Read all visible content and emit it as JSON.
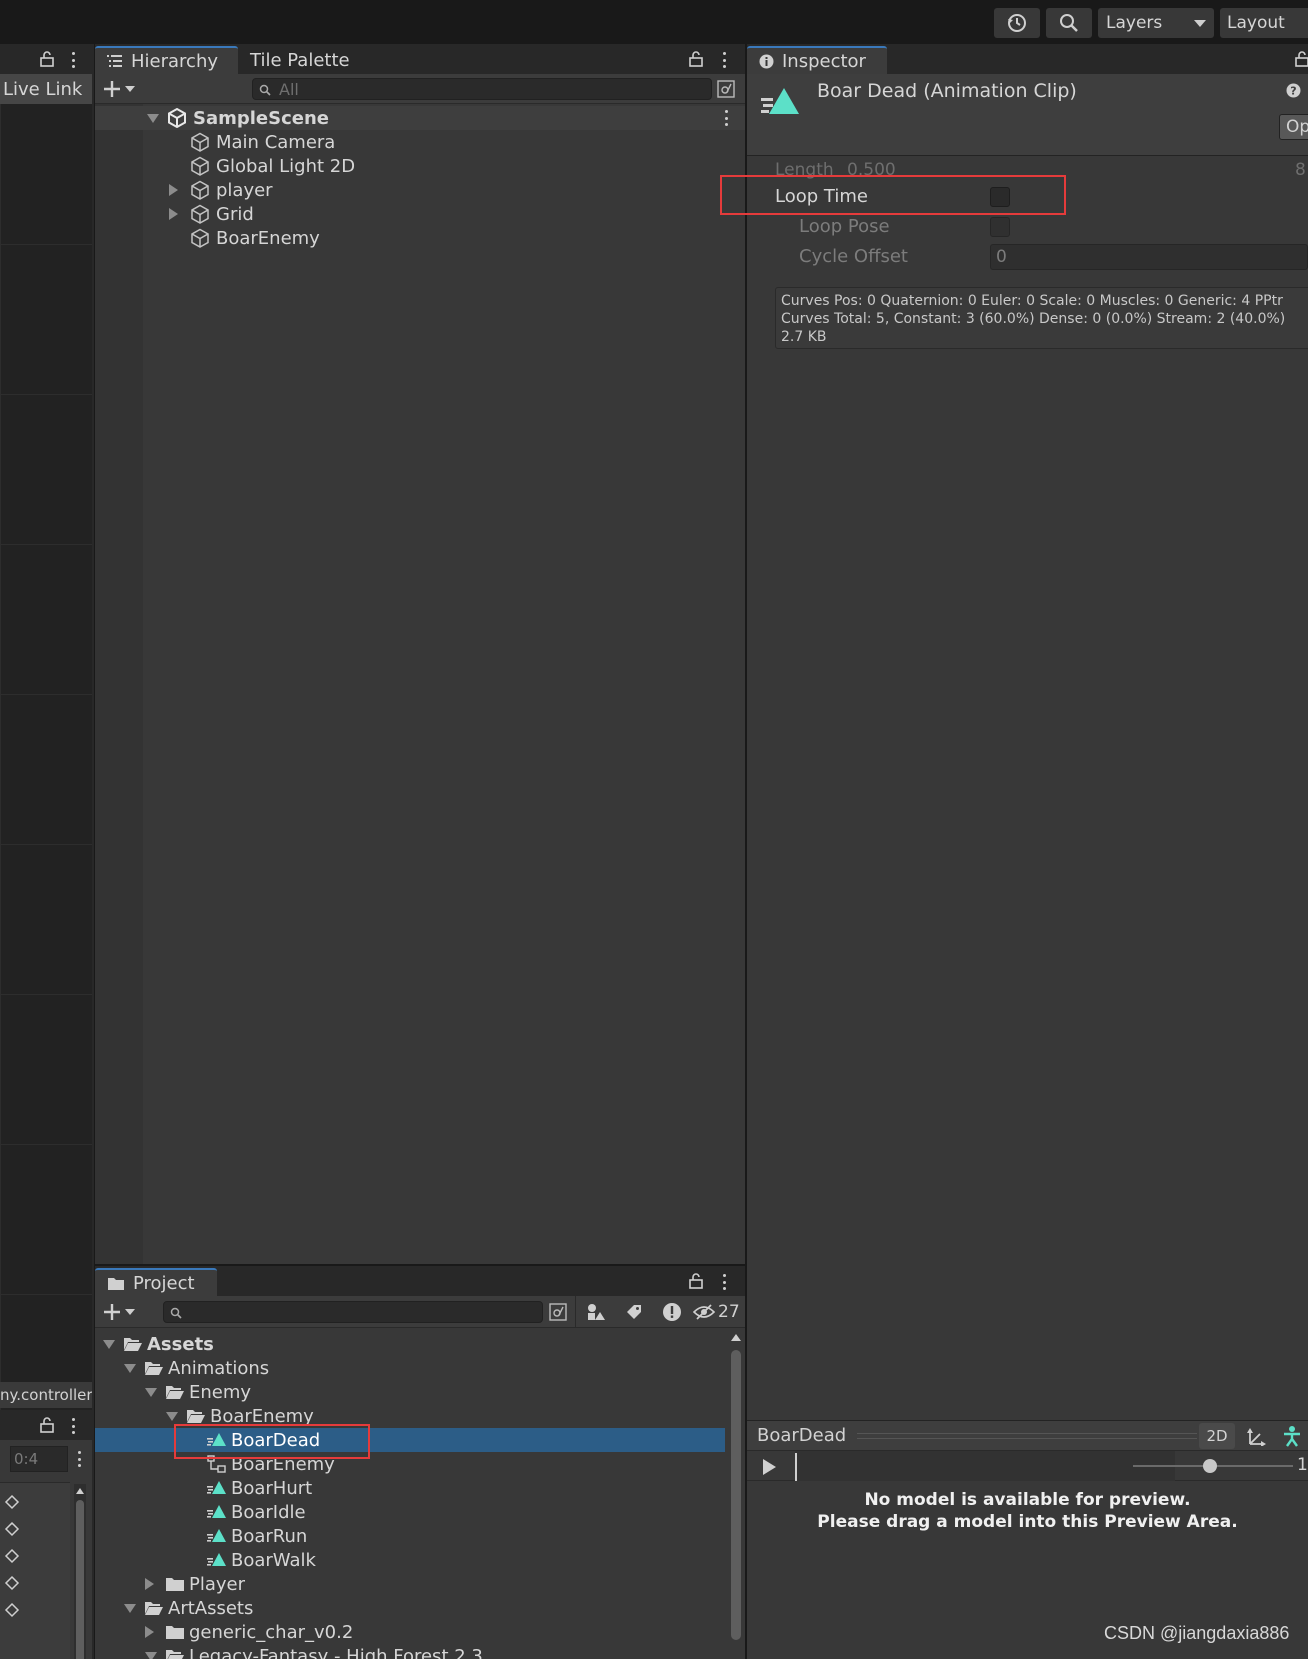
{
  "toolbar": {
    "history_icon": "history-icon",
    "search_icon": "search-icon",
    "layers_label": "Layers",
    "layout_label": "Layout"
  },
  "left_panel": {
    "live_link_label": "Live Link",
    "controller_label": "ny.controller",
    "frame_field": "0:4"
  },
  "hierarchy": {
    "tab_label": "Hierarchy",
    "tab2_label": "Tile Palette",
    "search_placeholder": "All",
    "scene_name": "SampleScene",
    "items": [
      {
        "label": "Main Camera",
        "expandable": false
      },
      {
        "label": "Global Light 2D",
        "expandable": false
      },
      {
        "label": "player",
        "expandable": true
      },
      {
        "label": "Grid",
        "expandable": true
      },
      {
        "label": "BoarEnemy",
        "expandable": false
      }
    ]
  },
  "inspector": {
    "tab_label": "Inspector",
    "title": "Boar Dead (Animation Clip)",
    "open_button": "Op",
    "length_label": "Length",
    "length_value": "0.500",
    "length_right": "8",
    "loop_time_label": "Loop Time",
    "loop_time_checked": false,
    "loop_pose_label": "Loop Pose",
    "cycle_offset_label": "Cycle Offset",
    "cycle_offset_value": "0",
    "info_lines": [
      "Curves Pos: 0 Quaternion: 0 Euler: 0 Scale: 0 Muscles: 0 Generic: 4 PPtr",
      "Curves Total: 5, Constant: 3 (60.0%) Dense: 0 (0.0%) Stream: 2 (40.0%)",
      "2.7 KB"
    ]
  },
  "preview": {
    "clip_name": "BoarDead",
    "mode_2d": "2D",
    "speed_value": "1.",
    "message_line1": "No model is available for preview.",
    "message_line2": "Please drag a model into this Preview Area."
  },
  "project": {
    "tab_label": "Project",
    "hidden_count": "27",
    "tree": [
      {
        "label": "Assets",
        "depth": 0,
        "icon": "folder-open-icon",
        "arrow": "down",
        "bold": true
      },
      {
        "label": "Animations",
        "depth": 1,
        "icon": "folder-open-icon",
        "arrow": "down"
      },
      {
        "label": "Enemy",
        "depth": 2,
        "icon": "folder-open-icon",
        "arrow": "down"
      },
      {
        "label": "BoarEnemy",
        "depth": 3,
        "icon": "folder-open-icon",
        "arrow": "down"
      },
      {
        "label": "BoarDead",
        "depth": 4,
        "icon": "animation-clip-icon",
        "arrow": "none",
        "selected": true
      },
      {
        "label": "BoarEnemy",
        "depth": 4,
        "icon": "animator-controller-icon",
        "arrow": "none"
      },
      {
        "label": "BoarHurt",
        "depth": 4,
        "icon": "animation-clip-icon",
        "arrow": "none"
      },
      {
        "label": "BoarIdle",
        "depth": 4,
        "icon": "animation-clip-icon",
        "arrow": "none"
      },
      {
        "label": "BoarRun",
        "depth": 4,
        "icon": "animation-clip-icon",
        "arrow": "none"
      },
      {
        "label": "BoarWalk",
        "depth": 4,
        "icon": "animation-clip-icon",
        "arrow": "none"
      },
      {
        "label": "Player",
        "depth": 2,
        "icon": "folder-icon",
        "arrow": "right"
      },
      {
        "label": "ArtAssets",
        "depth": 1,
        "icon": "folder-open-icon",
        "arrow": "down"
      },
      {
        "label": "generic_char_v0.2",
        "depth": 2,
        "icon": "folder-icon",
        "arrow": "right"
      },
      {
        "label": "Legacy-Fantasy - High Forest 2.3",
        "depth": 2,
        "icon": "folder-open-icon",
        "arrow": "down"
      }
    ]
  },
  "watermark": "CSDN @jiangdaxia886",
  "colors": {
    "panel_bg": "#383838",
    "selection": "#2c5d87",
    "highlight": "#e53b3b",
    "clip_icon": "#5ce0c8"
  }
}
